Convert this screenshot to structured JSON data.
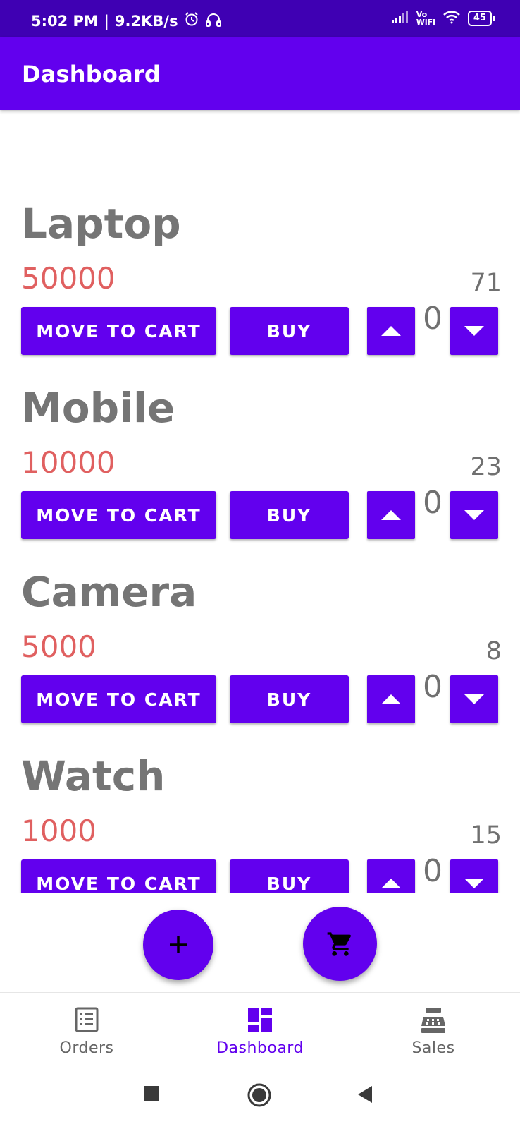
{
  "status_bar": {
    "time": "5:02 PM",
    "separator": "|",
    "speed": "9.2KB/s",
    "vowifi_top": "Vo",
    "vowifi_bottom": "WiFi",
    "battery": "45"
  },
  "app_bar": {
    "title": "Dashboard"
  },
  "products": [
    {
      "name": "Laptop",
      "price": "50000",
      "stock": "71",
      "qty": "0",
      "cart_label": "MOVE TO CART",
      "buy_label": "BUY"
    },
    {
      "name": "Mobile",
      "price": "10000",
      "stock": "23",
      "qty": "0",
      "cart_label": "MOVE TO CART",
      "buy_label": "BUY"
    },
    {
      "name": "Camera",
      "price": "5000",
      "stock": "8",
      "qty": "0",
      "cart_label": "MOVE TO CART",
      "buy_label": "BUY"
    },
    {
      "name": "Watch",
      "price": "1000",
      "stock": "15",
      "qty": "0",
      "cart_label": "MOVE TO CART",
      "buy_label": "BUY"
    }
  ],
  "fabs": {
    "add_icon": "plus-icon",
    "cart_icon": "cart-icon"
  },
  "bottom_nav": {
    "active": "Dashboard",
    "items": [
      {
        "label": "Orders",
        "icon": "orders-list-icon"
      },
      {
        "label": "Dashboard",
        "icon": "dashboard-icon"
      },
      {
        "label": "Sales",
        "icon": "cash-register-icon"
      }
    ]
  },
  "colors": {
    "primary": "#6200ee",
    "status_bar": "#3f00b3",
    "price": "#e06060",
    "text_gray": "#757575"
  }
}
